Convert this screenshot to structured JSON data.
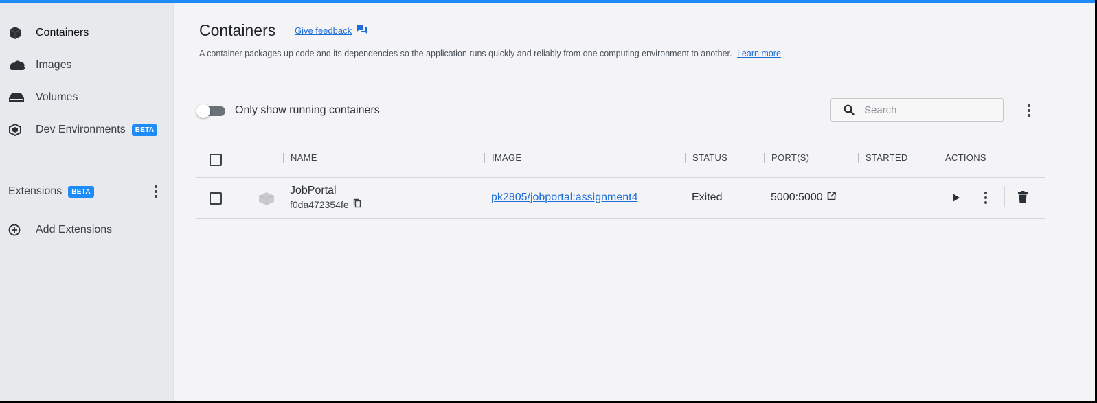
{
  "sidebar": {
    "items": [
      {
        "label": "Containers",
        "icon": "container-icon"
      },
      {
        "label": "Images",
        "icon": "cloud-icon"
      },
      {
        "label": "Volumes",
        "icon": "volume-drive-icon"
      },
      {
        "label": "Dev Environments",
        "icon": "cube-stack-icon",
        "badge": "BETA"
      }
    ],
    "extensions": {
      "label": "Extensions",
      "badge": "BETA"
    },
    "add_extensions": {
      "label": "Add Extensions"
    }
  },
  "header": {
    "title": "Containers",
    "feedback_label": "Give feedback",
    "description": "A container packages up code and its dependencies so the application runs quickly and reliably from one computing environment to another.",
    "learn_more": "Learn more"
  },
  "filter": {
    "toggle_label": "Only show running containers",
    "toggle_on": false
  },
  "search": {
    "placeholder": "Search",
    "value": ""
  },
  "table": {
    "columns": [
      "NAME",
      "IMAGE",
      "STATUS",
      "PORT(S)",
      "STARTED",
      "ACTIONS"
    ],
    "rows": [
      {
        "name": "JobPortal",
        "id": "f0da472354fe",
        "image": "pk2805/jobportal:assignment4",
        "status": "Exited",
        "ports": "5000:5000",
        "started": ""
      }
    ]
  },
  "colors": {
    "accent": "#1d8cf8",
    "link": "#1d6ed8",
    "sidebar_bg": "#e8e9ec",
    "main_bg": "#f4f4f6"
  }
}
